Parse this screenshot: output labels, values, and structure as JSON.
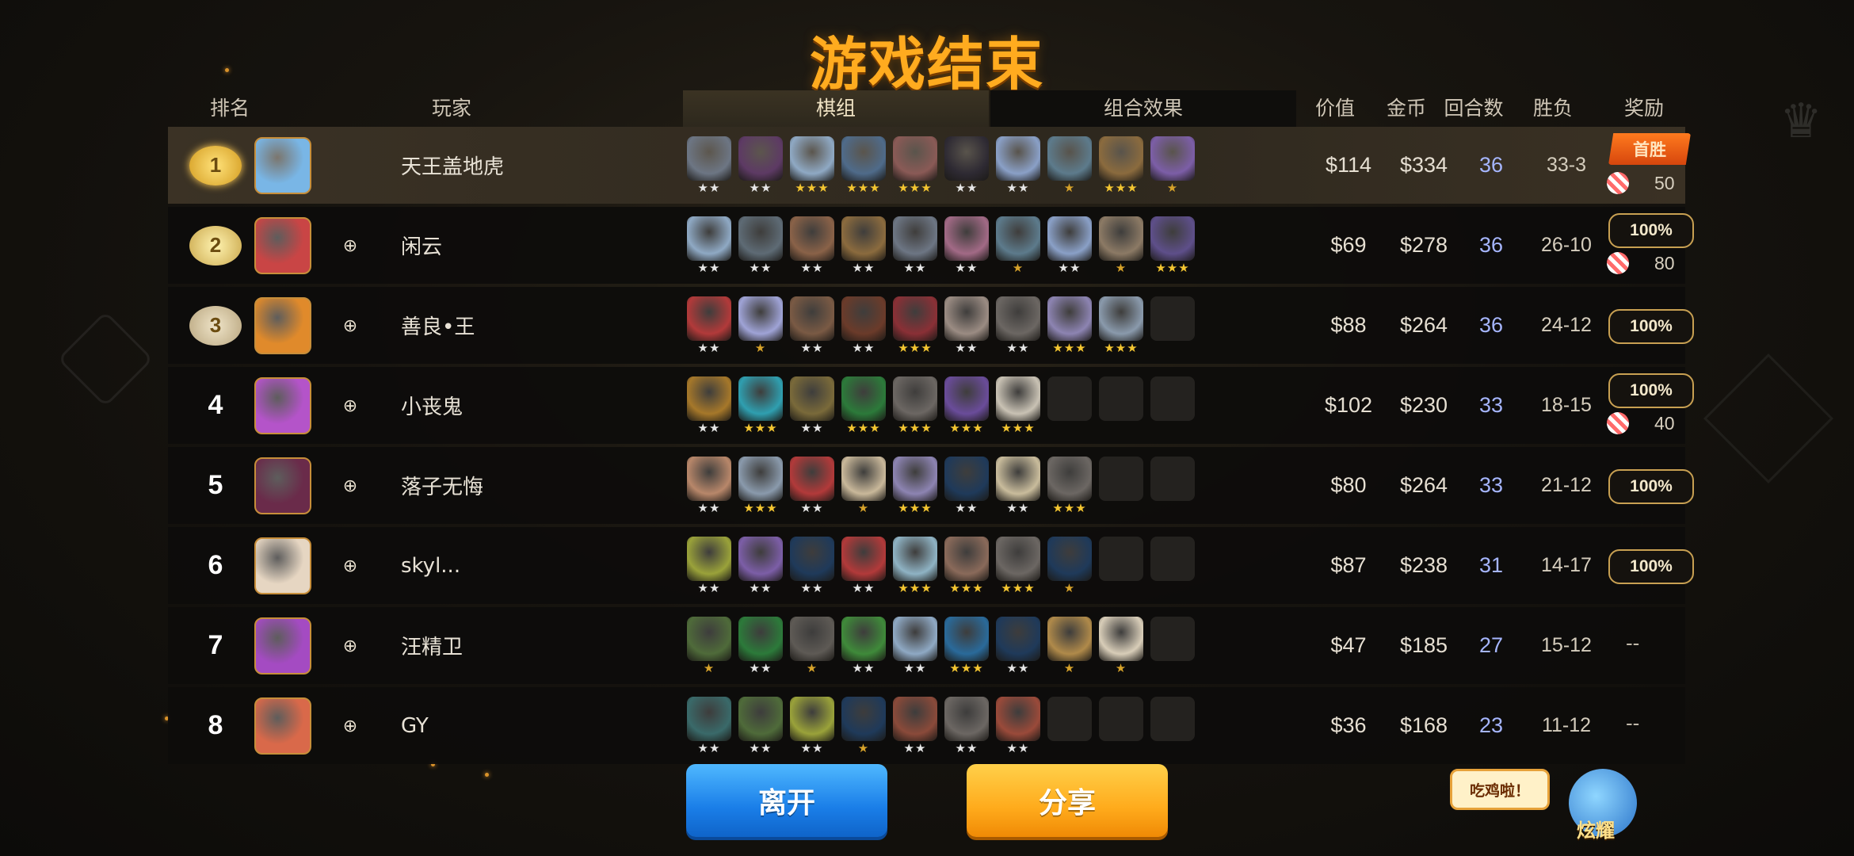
{
  "title": "游戏结束",
  "headers": {
    "rank": "排名",
    "player": "玩家",
    "lineup": "棋组",
    "synergy": "组合效果",
    "value": "价值",
    "gold": "金币",
    "rounds": "回合数",
    "record": "胜负",
    "reward": "奖励"
  },
  "rows": [
    {
      "rank": "1",
      "rank_display": "medal-gold",
      "name": "天王盖地虎",
      "friend_icon": false,
      "avatar_color": "#79b6e6",
      "value": "$114",
      "gold": "$334",
      "rounds": "36",
      "record": "33-3",
      "reward": {
        "badge": "首胜",
        "candy": "50"
      },
      "pieces": [
        {
          "color": "#6d7684",
          "stars": "★★"
        },
        {
          "color": "#5d3a64",
          "stars": "★★"
        },
        {
          "color": "#8fa9c4",
          "stars": "★★★"
        },
        {
          "color": "#4f6b8a",
          "stars": "★★★"
        },
        {
          "color": "#8a5a56",
          "stars": "★★★"
        },
        {
          "color": "#2e2a33",
          "stars": "★★"
        },
        {
          "color": "#8aa0c7",
          "stars": "★★"
        },
        {
          "color": "#5d7b8c",
          "stars": "★"
        },
        {
          "color": "#8b6b3e",
          "stars": "★★★"
        },
        {
          "color": "#7c5ea7",
          "stars": "★"
        }
      ]
    },
    {
      "rank": "2",
      "rank_display": "medal-silver",
      "name": "闲云",
      "friend_icon": true,
      "avatar_color": "#c94545",
      "value": "$69",
      "gold": "$278",
      "rounds": "36",
      "record": "26-10",
      "reward": {
        "badge": "100%",
        "candy": "80"
      },
      "pieces": [
        {
          "color": "#8fa9c4",
          "stars": "★★"
        },
        {
          "color": "#5e6b75",
          "stars": "★★"
        },
        {
          "color": "#8a6248",
          "stars": "★★"
        },
        {
          "color": "#8b6b3e",
          "stars": "★★"
        },
        {
          "color": "#6d7684",
          "stars": "★★"
        },
        {
          "color": "#a26a86",
          "stars": "★★"
        },
        {
          "color": "#5d7b8c",
          "stars": "★"
        },
        {
          "color": "#8aa0c7",
          "stars": "★★"
        },
        {
          "color": "#8c7a65",
          "stars": "★"
        },
        {
          "color": "#5e4f8a",
          "stars": "★★★"
        }
      ]
    },
    {
      "rank": "3",
      "rank_display": "medal-bronze",
      "name": "善良•王",
      "friend_icon": true,
      "avatar_color": "#e08a2b",
      "value": "$88",
      "gold": "$264",
      "rounds": "36",
      "record": "24-12",
      "reward": {
        "badge": "100%",
        "candy": ""
      },
      "pieces": [
        {
          "color": "#b23a3a",
          "stars": "★★"
        },
        {
          "color": "#9fa3d6",
          "stars": "★"
        },
        {
          "color": "#7a5a44",
          "stars": "★★"
        },
        {
          "color": "#6b3b2a",
          "stars": "★★"
        },
        {
          "color": "#8a3036",
          "stars": "★★★"
        },
        {
          "color": "#9b8c83",
          "stars": "★★"
        },
        {
          "color": "#6c6763",
          "stars": "★★"
        },
        {
          "color": "#8d84b2",
          "stars": "★★★"
        },
        {
          "color": "#8a9aac",
          "stars": "★★★"
        },
        {
          "color": "",
          "stars": ""
        }
      ]
    },
    {
      "rank": "4",
      "rank_display": "number",
      "name": "小丧鬼",
      "friend_icon": true,
      "avatar_color": "#b454c9",
      "value": "$102",
      "gold": "$230",
      "rounds": "33",
      "record": "18-15",
      "reward": {
        "badge": "100%",
        "candy": "40"
      },
      "pieces": [
        {
          "color": "#a6782a",
          "stars": "★★"
        },
        {
          "color": "#2f9fb0",
          "stars": "★★★"
        },
        {
          "color": "#7a6a3a",
          "stars": "★★"
        },
        {
          "color": "#2c7a3a",
          "stars": "★★★"
        },
        {
          "color": "#6c6763",
          "stars": "★★★"
        },
        {
          "color": "#6a4c9a",
          "stars": "★★★"
        },
        {
          "color": "#c9c2b4",
          "stars": "★★★"
        },
        {
          "color": "",
          "stars": ""
        },
        {
          "color": "",
          "stars": ""
        },
        {
          "color": "",
          "stars": ""
        }
      ]
    },
    {
      "rank": "5",
      "rank_display": "number",
      "name": "落子无悔",
      "friend_icon": true,
      "avatar_color": "#6a2b4a",
      "value": "$80",
      "gold": "$264",
      "rounds": "33",
      "record": "21-12",
      "reward": {
        "badge": "100%",
        "candy": ""
      },
      "pieces": [
        {
          "color": "#b8876a",
          "stars": "★★"
        },
        {
          "color": "#8a9aac",
          "stars": "★★★"
        },
        {
          "color": "#b23a3a",
          "stars": "★★"
        },
        {
          "color": "#c9b89a",
          "stars": "★"
        },
        {
          "color": "#8d84b2",
          "stars": "★★★"
        },
        {
          "color": "#1f3a5a",
          "stars": "★★"
        },
        {
          "color": "#c9bc9c",
          "stars": "★★"
        },
        {
          "color": "#6c6763",
          "stars": "★★★"
        },
        {
          "color": "",
          "stars": ""
        },
        {
          "color": "",
          "stars": ""
        }
      ]
    },
    {
      "rank": "6",
      "rank_display": "number",
      "name": "skyl...",
      "friend_icon": true,
      "avatar_color": "#e6d6c2",
      "value": "$87",
      "gold": "$238",
      "rounds": "31",
      "record": "14-17",
      "reward": {
        "badge": "100%",
        "candy": ""
      },
      "pieces": [
        {
          "color": "#9aa23a",
          "stars": "★★"
        },
        {
          "color": "#7c5ea7",
          "stars": "★★"
        },
        {
          "color": "#1f3a5a",
          "stars": "★★"
        },
        {
          "color": "#b23a3a",
          "stars": "★★"
        },
        {
          "color": "#8fb3c4",
          "stars": "★★★"
        },
        {
          "color": "#8a6a5a",
          "stars": "★★★"
        },
        {
          "color": "#6c6763",
          "stars": "★★★"
        },
        {
          "color": "#1f3a5a",
          "stars": "★"
        },
        {
          "color": "",
          "stars": ""
        },
        {
          "color": "",
          "stars": ""
        }
      ]
    },
    {
      "rank": "7",
      "rank_display": "number",
      "name": "汪精卫",
      "friend_icon": true,
      "avatar_color": "#a44bc2",
      "value": "$47",
      "gold": "$185",
      "rounds": "27",
      "record": "15-12",
      "reward": {
        "badge": "",
        "candy": "",
        "dash": "--"
      },
      "pieces": [
        {
          "color": "#4f6b3a",
          "stars": "★"
        },
        {
          "color": "#2c7a3a",
          "stars": "★★"
        },
        {
          "color": "#5e5a55",
          "stars": "★"
        },
        {
          "color": "#3f8a3a",
          "stars": "★★"
        },
        {
          "color": "#8fa9c4",
          "stars": "★★"
        },
        {
          "color": "#2a6a9a",
          "stars": "★★★"
        },
        {
          "color": "#1f3a5a",
          "stars": "★★"
        },
        {
          "color": "#b08a4a",
          "stars": "★"
        },
        {
          "color": "#d8cdb8",
          "stars": "★"
        },
        {
          "color": "",
          "stars": ""
        }
      ]
    },
    {
      "rank": "8",
      "rank_display": "number",
      "name": "GY",
      "friend_icon": true,
      "avatar_color": "#d9694a",
      "value": "$36",
      "gold": "$168",
      "rounds": "23",
      "record": "11-12",
      "reward": {
        "badge": "",
        "candy": "",
        "dash": "--"
      },
      "pieces": [
        {
          "color": "#3a6a6a",
          "stars": "★★"
        },
        {
          "color": "#4f6b3a",
          "stars": "★★"
        },
        {
          "color": "#9aa23a",
          "stars": "★★"
        },
        {
          "color": "#1f3a5a",
          "stars": "★"
        },
        {
          "color": "#8a4a3a",
          "stars": "★★"
        },
        {
          "color": "#6c6763",
          "stars": "★★"
        },
        {
          "color": "#9a4a3a",
          "stars": "★★"
        },
        {
          "color": "",
          "stars": ""
        },
        {
          "color": "",
          "stars": ""
        },
        {
          "color": "",
          "stars": ""
        }
      ]
    }
  ],
  "buttons": {
    "leave": "离开",
    "share": "分享"
  },
  "mascot": {
    "bubble": "吃鸡啦！",
    "label": "炫耀"
  },
  "icons": {
    "friend": "add-friend-icon",
    "candy": "candy-icon",
    "crown": "crown-icon"
  }
}
